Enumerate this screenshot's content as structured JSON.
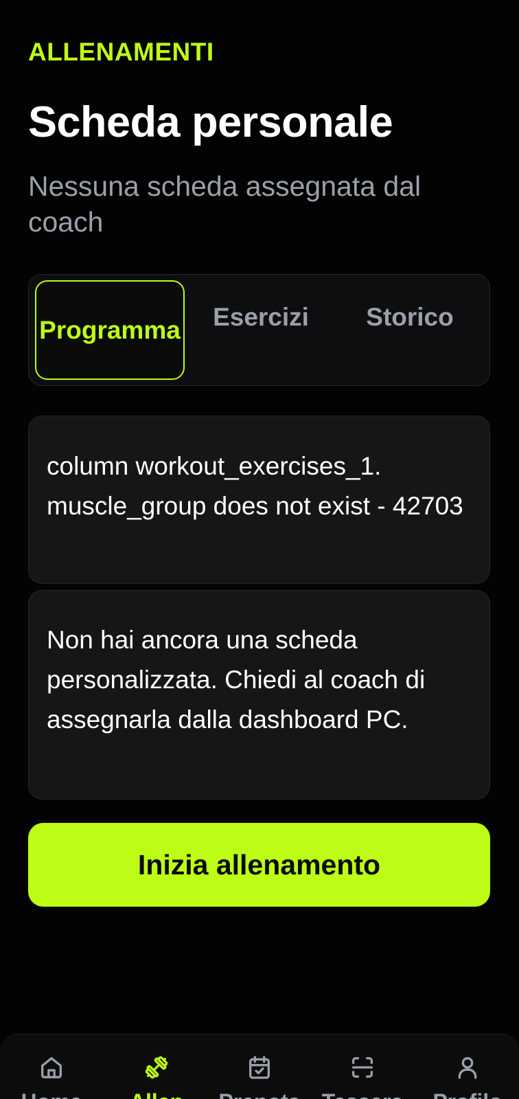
{
  "header": {
    "section_label": "ALLENAMENTI",
    "title": "Scheda personale",
    "subtitle": "Nessuna scheda assegnata dal coach"
  },
  "tabs": [
    {
      "label": "Programma",
      "active": true
    },
    {
      "label": "Esercizi",
      "active": false
    },
    {
      "label": "Storico",
      "active": false
    }
  ],
  "error_card": {
    "text": "column workout_exercises_1. muscle_group does not exist - 42703"
  },
  "info_card": {
    "text": "Non hai ancora una scheda personalizzata. Chiedi al coach di assegnarla dalla dashboard PC."
  },
  "primary_button": {
    "label": "Inizia allenamento"
  },
  "bottom_nav": {
    "items": [
      {
        "label": "Home",
        "icon": "home-icon",
        "active": false
      },
      {
        "label": "Allen",
        "icon": "dumbbell-icon",
        "active": true
      },
      {
        "label": "Prenota",
        "icon": "calendar-check-icon",
        "active": false
      },
      {
        "label": "Tessera",
        "icon": "scan-icon",
        "active": false
      },
      {
        "label": "Profilo",
        "icon": "user-icon",
        "active": false
      }
    ]
  },
  "colors": {
    "accent": "#bdfc14",
    "background": "#030303",
    "card": "#161618",
    "muted_text": "#9aa0aa"
  }
}
